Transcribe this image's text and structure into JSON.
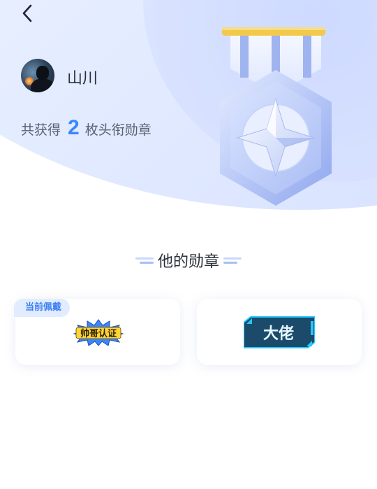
{
  "header": {
    "back_icon": "chevron-left-icon"
  },
  "profile": {
    "username": "山川",
    "avatar_icon": "user-avatar"
  },
  "summary": {
    "prefix": "共获得",
    "count": "2",
    "suffix": "枚头衔勋章"
  },
  "hero": {
    "medal_icon": "medal-icon"
  },
  "section": {
    "title": "他的勋章"
  },
  "badges": [
    {
      "tag": "当前佩戴",
      "label": "帅哥认证",
      "icon": "badge-handsome-icon"
    },
    {
      "label": "大佬",
      "icon": "badge-bigshot-icon"
    }
  ],
  "colors": {
    "accent": "#3a86ff",
    "tag_bg": "#e2ecff",
    "tag_text": "#3a7ff2"
  }
}
